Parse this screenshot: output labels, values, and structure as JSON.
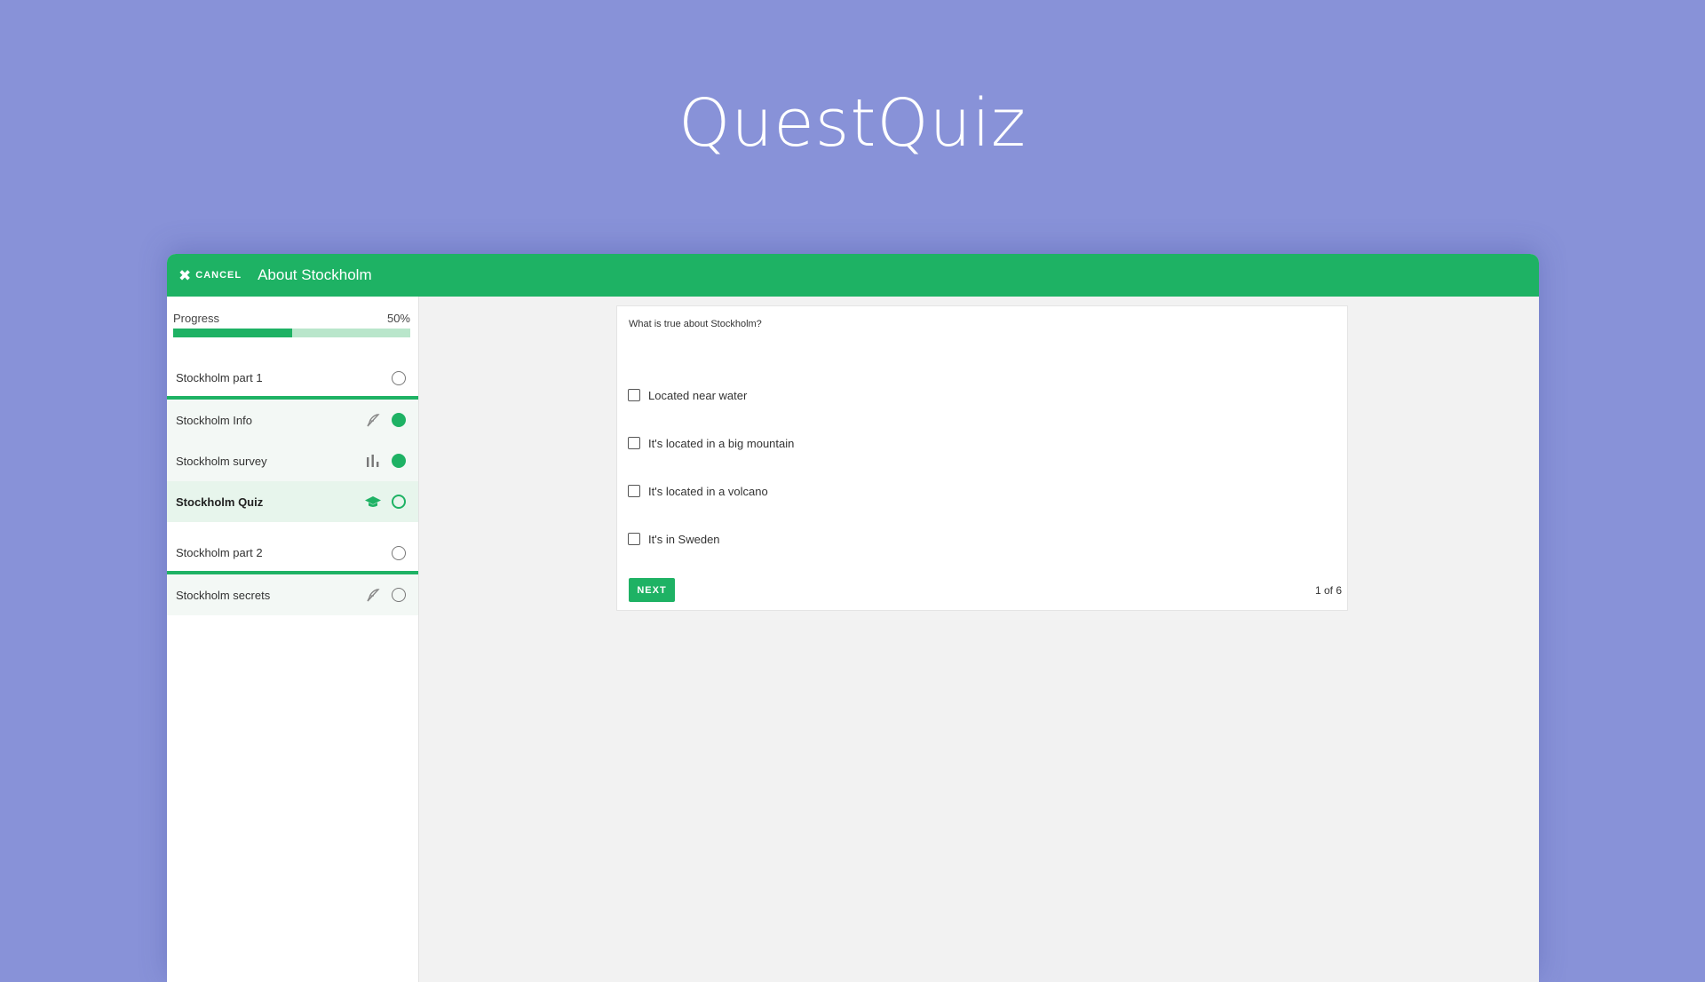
{
  "hero": {
    "title": "QuestQuiz"
  },
  "topbar": {
    "cancel_label": "CANCEL",
    "course_title": "About Stockholm"
  },
  "progress": {
    "label": "Progress",
    "percent_text": "50%",
    "value": 0.5
  },
  "sidebar": {
    "sections": [
      {
        "title": "Stockholm part 1",
        "items": [
          {
            "label": "Stockholm Info",
            "icon": "feather-icon",
            "status": "done"
          },
          {
            "label": "Stockholm survey",
            "icon": "bar-chart-icon",
            "status": "done"
          },
          {
            "label": "Stockholm Quiz",
            "icon": "graduation-cap-icon",
            "status": "todo",
            "active": true
          }
        ]
      },
      {
        "title": "Stockholm part 2",
        "items": [
          {
            "label": "Stockholm secrets",
            "icon": "feather-icon",
            "status": "empty"
          }
        ]
      }
    ]
  },
  "quiz": {
    "question": "What is true about Stockholm?",
    "answers": [
      "Located near water",
      "It's located in a big mountain",
      "It's located in a volcano",
      "It's in Sweden"
    ],
    "next_label": "NEXT",
    "pager": "1 of 6"
  },
  "colors": {
    "brand": "#1eb264",
    "background": "#8892d8"
  }
}
